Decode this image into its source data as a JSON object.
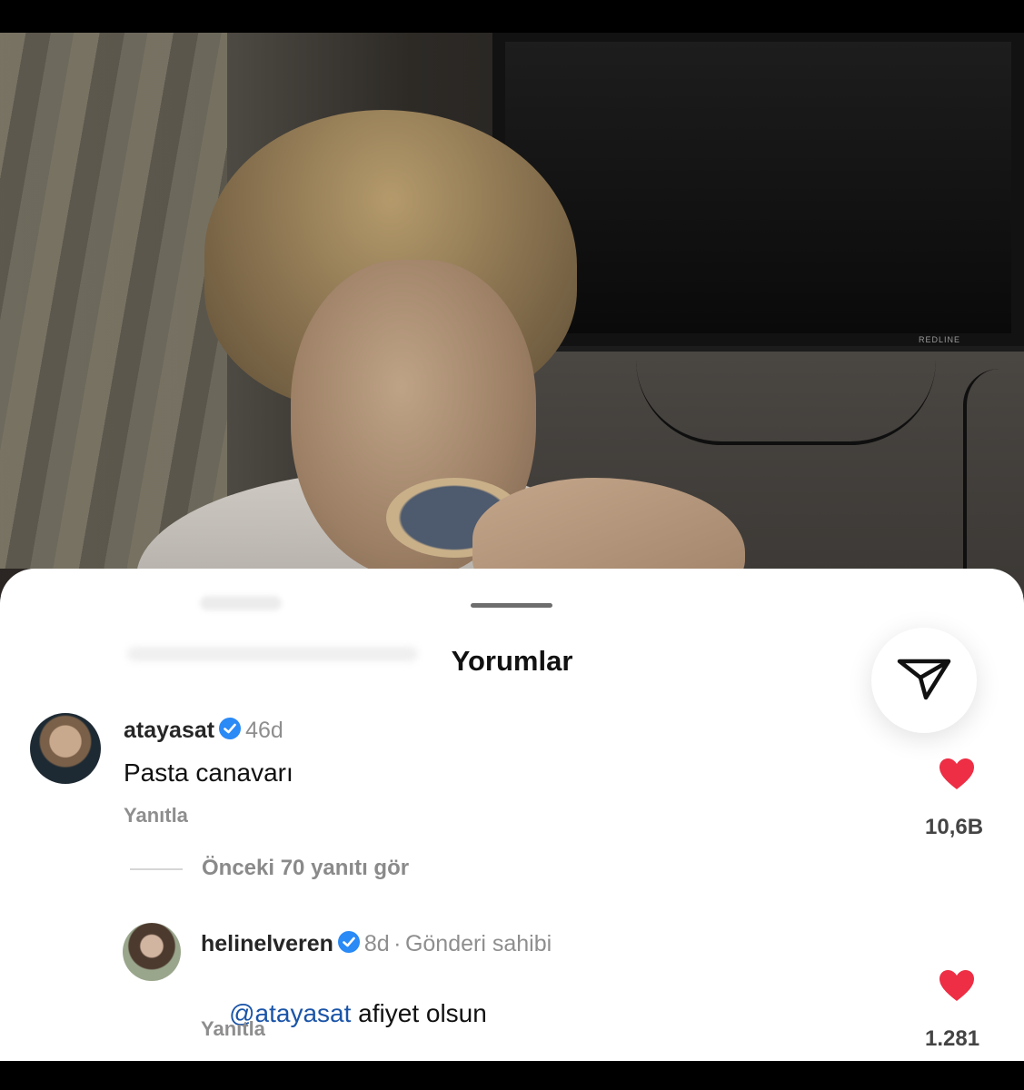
{
  "sheet": {
    "title": "Yorumlar",
    "send_icon": "paper-plane-icon"
  },
  "comments": [
    {
      "username": "atayasat",
      "verified": true,
      "age": "46d",
      "text": "Pasta canavarı",
      "reply_label": "Yanıtla",
      "likes": "10,6B",
      "liked": true
    }
  ],
  "view_previous_replies": "Önceki 70 yanıtı gör",
  "replies": [
    {
      "username": "helinelveren",
      "verified": true,
      "age": "8d",
      "separator": "·",
      "owner_label": "Gönderi sahibi",
      "mention": "@atayasat",
      "text": " afiyet olsun",
      "reply_label": "Yanıtla",
      "likes": "1.281",
      "liked": true
    }
  ],
  "colors": {
    "heart": "#ed2e45",
    "verified": "#2a8af6",
    "mention": "#1a54a8"
  }
}
